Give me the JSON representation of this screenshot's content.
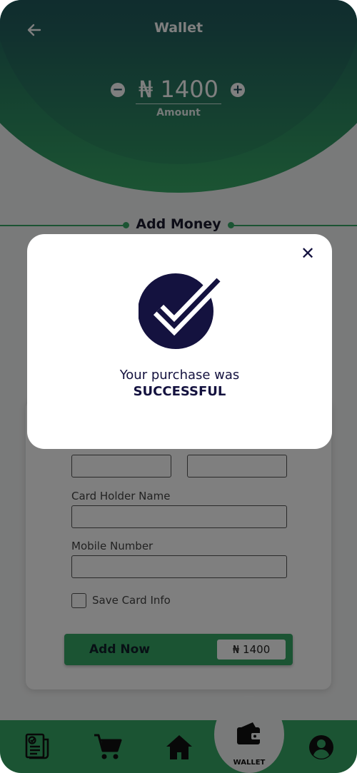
{
  "header": {
    "title": "Wallet",
    "amount": "₦ 1400",
    "amount_label": "Amount"
  },
  "section": {
    "title": "Add Money"
  },
  "form": {
    "card_holder_label": "Card Holder Name",
    "mobile_label": "Mobile Number",
    "save_card_label": "Save Card Info",
    "save_card_checked": false,
    "add_now_label": "Add Now",
    "add_now_amount": "₦ 1400"
  },
  "nav": {
    "items": [
      {
        "icon": "receipt-icon"
      },
      {
        "icon": "cart-icon"
      },
      {
        "icon": "home-icon"
      },
      {
        "icon": "wallet-icon",
        "label": "WALLET",
        "active": true
      },
      {
        "icon": "profile-icon"
      }
    ]
  },
  "modal": {
    "message_line1": "Your purchase was",
    "message_line2": "SUCCESSFUL",
    "icon": "check-circle-icon"
  },
  "colors": {
    "accent": "#37a866",
    "navy": "#14123f",
    "header_top": "#17304f"
  }
}
